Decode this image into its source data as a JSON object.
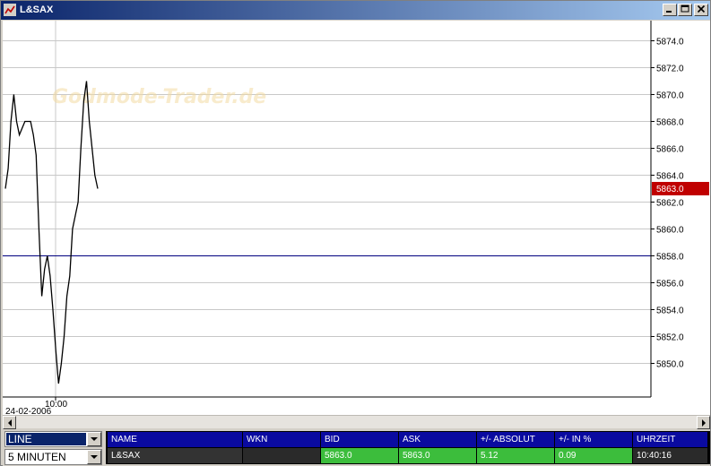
{
  "window": {
    "title": "L&SAX",
    "colors": {
      "titlebar": "#0a246a",
      "price_marker": "#c00000",
      "baseline": "#000080",
      "bid_ask_fill": "#3cbd3c",
      "quote_header": "#0a0aa0"
    }
  },
  "window_buttons": {
    "minimize_icon": "minimize-icon",
    "maximize_icon": "maximize-icon",
    "close_icon": "close-icon"
  },
  "chart_data": {
    "type": "line",
    "title": "",
    "x_tick_label": "10:00",
    "date_label": "24-02-2006",
    "watermark": "Godmode-Trader.de",
    "y_ticks": [
      "5874.0",
      "5872.0",
      "5870.0",
      "5868.0",
      "5866.0",
      "5864.0",
      "5862.0",
      "5860.0",
      "5858.0",
      "5856.0",
      "5854.0",
      "5852.0",
      "5850.0"
    ],
    "ylim": [
      5847.5,
      5875.5
    ],
    "current_price_label": "5863.0",
    "current_price": 5863.0,
    "reference_line": 5858.0,
    "grid": true,
    "series": [
      {
        "values": [
          5863.0,
          5864.5,
          5868.0,
          5870.0,
          5868.0,
          5867.0,
          5867.5,
          5868.0,
          5868.0,
          5868.0,
          5867.0,
          5865.5,
          5860.0,
          5855.0,
          5857.0,
          5858.0,
          5856.5,
          5854.0,
          5851.0,
          5848.5,
          5850.0,
          5852.0,
          5855.0,
          5856.5,
          5860.0,
          5861.0,
          5862.0,
          5866.0,
          5869.5,
          5871.0,
          5868.0,
          5866.0,
          5864.0,
          5863.0
        ]
      }
    ]
  },
  "controls": {
    "chart_type": "LINE",
    "interval": "5 MINUTEN"
  },
  "quote_table": {
    "headers": [
      "NAME",
      "WKN",
      "BID",
      "ASK",
      "+/- ABSOLUT",
      "+/- IN %",
      "UHRZEIT"
    ],
    "row": [
      "L&SAX",
      "",
      "5863.0",
      "5863.0",
      "5.12",
      "0.09",
      "10:40:16"
    ]
  }
}
